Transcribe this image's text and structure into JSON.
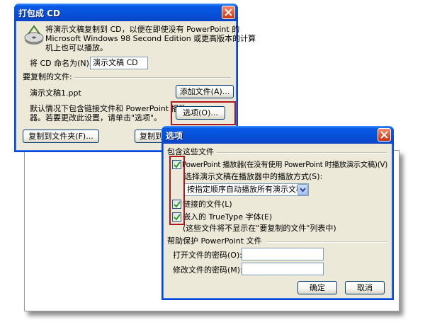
{
  "dialog1": {
    "title": "打包成 CD",
    "desc_line1": "将演示文稿复制到 CD，以便在即使没有 PowerPoint 的",
    "desc_line2": "Microsoft Windows 98 Second Edition 或更高版本的计算",
    "desc_line3": "机上也可以播放。",
    "name_label": "将 CD 命名为(N):",
    "name_value": "演示文稿 CD",
    "files_label": "要复制的文件:",
    "file_item": "演示文稿1.ppt",
    "add_files_button": "添加文件(A)...",
    "info_line1": "默认情况下包含链接文件和 PowerPoint 播放",
    "info_line2": "器。若要更改此设置，请单击\"选项\"。",
    "options_button": "选项(O)...",
    "copy_folder_button": "复制到文件夹(F)...",
    "copy_cd_button": "复制到"
  },
  "dialog2": {
    "title": "选项",
    "include_group": "包含这些文件",
    "opt_player": "PowerPoint 播放器(在没有使用 PowerPoint 时播放演示文稿)(V)",
    "play_mode_label": "选择演示文稿在播放器中的播放方式(S):",
    "play_mode_value": "按指定顺序自动播放所有演示文稿",
    "opt_linked": "链接的文件(L)",
    "opt_embed": "嵌入的 TrueType 字体(E)",
    "note": "(这些文件将不显示在\"要复制的文件\"列表中)",
    "password_group": "帮助保护 PowerPoint 文件",
    "open_pwd_label": "打开文件的密码(O):",
    "modify_pwd_label": "修改文件的密码(M):",
    "open_pwd_value": "",
    "modify_pwd_value": "",
    "ok_button": "确定",
    "cancel_button": "取消",
    "checked": [
      true,
      true,
      true
    ]
  },
  "colors": {
    "titlebar": "#0650d8",
    "dialog_bg": "#ece9d8",
    "highlight": "#b0161c",
    "close_button": "#e05530"
  }
}
